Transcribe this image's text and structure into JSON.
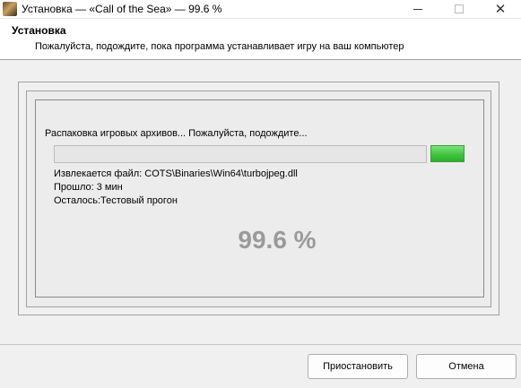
{
  "window": {
    "title": "Установка — «Call of the Sea» — 99.6 %",
    "icons": {
      "app": "game-app-icon",
      "minimize": "minimize-icon",
      "maximize": "maximize-icon",
      "close": "close-icon"
    },
    "close_glyph": "✕"
  },
  "header": {
    "title": "Установка",
    "subtitle": "Пожалуйста, подождите, пока программа устанавливает игру на ваш компьютер"
  },
  "install": {
    "status_text": "Распаковка игровых архивов... Пожалуйста, подождите...",
    "progress_fraction": 0.996,
    "progress_color": "#3fc43f",
    "extracting_file": "Извлекается файл: COTS\\Binaries\\Win64\\turbojpeg.dll",
    "elapsed": "Прошло: 3 мин",
    "remaining": "Осталось:Тестовый прогон",
    "percent_text": "99.6 %"
  },
  "buttons": {
    "pause": "Приостановить",
    "cancel": "Отмена"
  }
}
